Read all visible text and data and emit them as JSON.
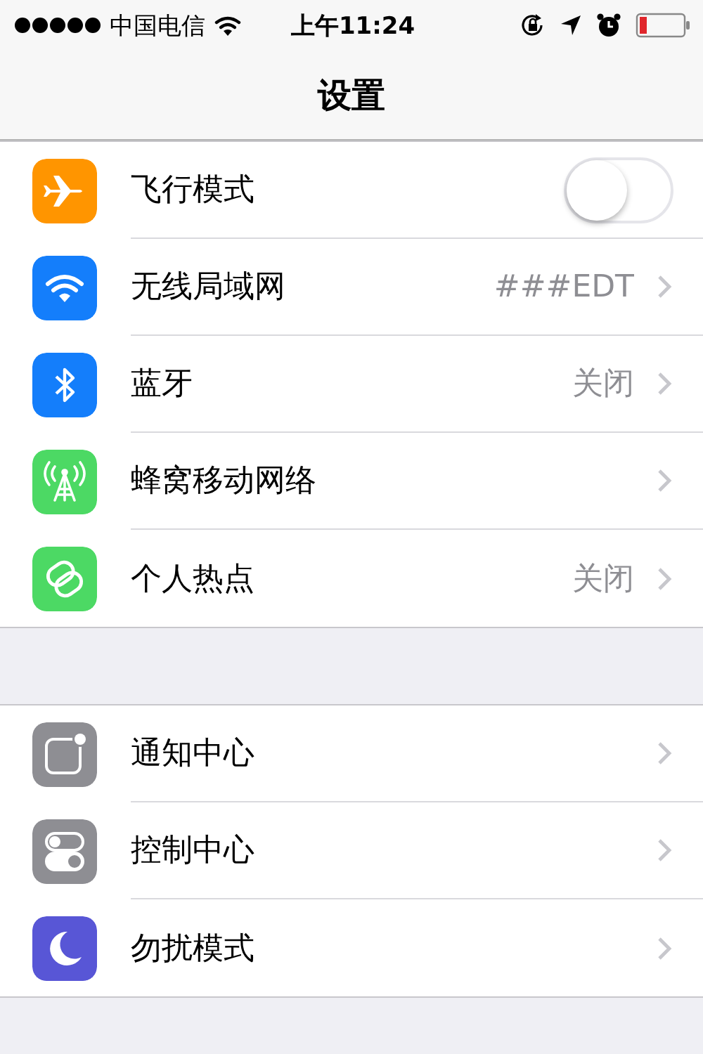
{
  "status_bar": {
    "carrier": "中国电信",
    "time": "上午11:24"
  },
  "nav_bar": {
    "title": "设置"
  },
  "groups": [
    {
      "rows": [
        {
          "label": "飞行模式",
          "color": "#ff9500",
          "kind": "toggle",
          "on": false
        },
        {
          "label": "无线局域网",
          "color": "#147efb",
          "kind": "link",
          "value": "###EDT"
        },
        {
          "label": "蓝牙",
          "color": "#147efb",
          "kind": "link",
          "value": "关闭"
        },
        {
          "label": "蜂窝移动网络",
          "color": "#4cd964",
          "kind": "link"
        },
        {
          "label": "个人热点",
          "color": "#4cd964",
          "kind": "link",
          "value": "关闭"
        }
      ]
    },
    {
      "rows": [
        {
          "label": "通知中心",
          "color": "#8e8e93",
          "kind": "link"
        },
        {
          "label": "控制中心",
          "color": "#8e8e93",
          "kind": "link"
        },
        {
          "label": "勿扰模式",
          "color": "#5856d6",
          "kind": "link"
        }
      ]
    }
  ]
}
